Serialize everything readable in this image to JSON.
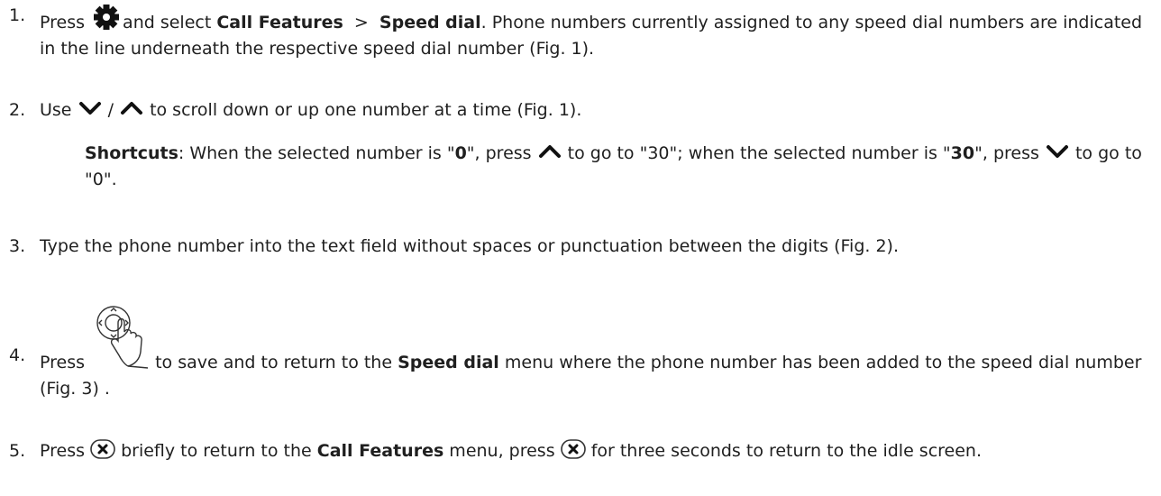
{
  "steps": [
    {
      "num": "1.",
      "t1": "Press ",
      "t2": "and select ",
      "b1": "Call Features",
      "t3": "  >  ",
      "b2": "Speed dial",
      "t4": ".  Phone numbers currently assigned to any speed dial numbers are indicated in the line underneath the respective speed dial number (Fig. 1)."
    },
    {
      "num": "2.",
      "t1": "Use ",
      "t2": " / ",
      "t3": " to scroll down or up one number at a time (Fig. 1)."
    },
    {
      "num": "3.",
      "t1": "Type the phone number into the text field without spaces or punctuation between the digits (Fig. 2)."
    },
    {
      "num": "4.",
      "t1": "Press ",
      "t2": " to save and to return to the ",
      "b1": "Speed dial",
      "t3": " menu where the phone number has been added to the speed dial number (Fig. 3) ."
    },
    {
      "num": "5.",
      "t1": "Press ",
      "t2": " briefly to return to the ",
      "b1": "Call Features",
      "t3": " menu, press ",
      "t4": " for three seconds to return to the idle screen."
    }
  ],
  "shortcut": {
    "label": "Shortcuts",
    "t1": ":  When the selected number is \"",
    "b1": "0",
    "t2": "\", press ",
    "t3": " to go to \"30\"; when the selected number is \"",
    "b2": "30",
    "t4": "\", press ",
    "t5": " to go to \"0\"."
  },
  "icons": {
    "settings": "gear-icon",
    "down": "chevron-down-icon",
    "up": "chevron-up-icon",
    "nav_key": "navigation-key-press-icon",
    "close": "close-key-icon"
  }
}
